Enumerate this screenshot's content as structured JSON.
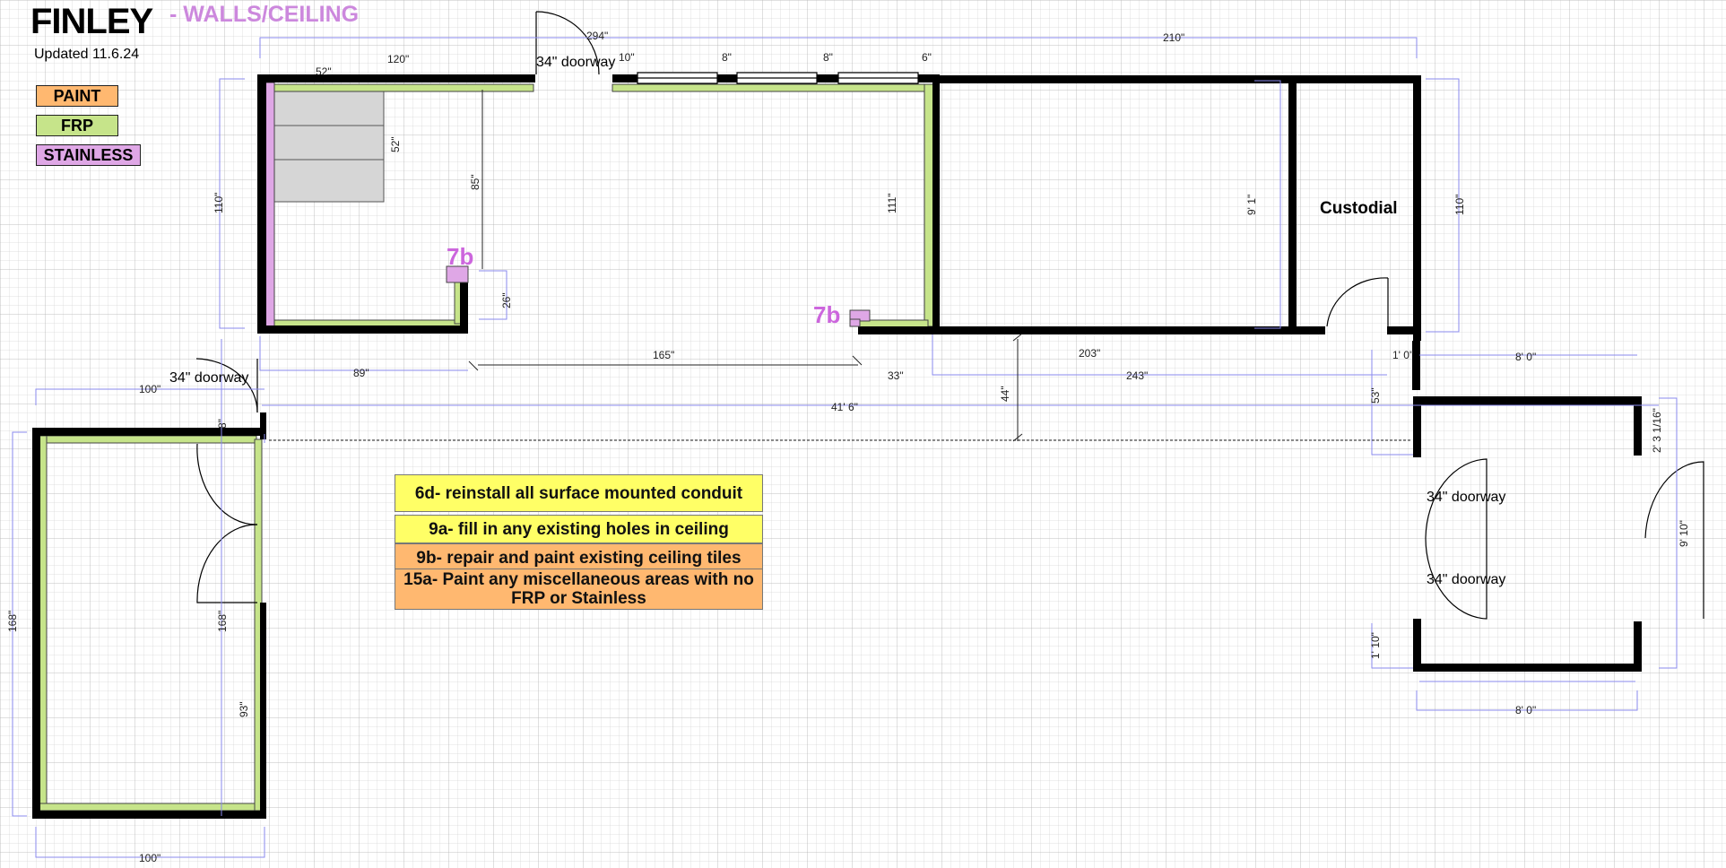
{
  "header": {
    "title": "FINLEY",
    "subtitle": "- WALLS/CEILING",
    "updated": "Updated 11.6.24"
  },
  "legend": {
    "items": [
      {
        "label": "PAINT",
        "color": "#ffb870"
      },
      {
        "label": "FRP",
        "color": "#c6e48a"
      },
      {
        "label": "STAINLESS",
        "color": "#dfa7e6"
      }
    ]
  },
  "notes": [
    {
      "text": "6d- reinstall all surface mounted conduit",
      "color": "#ffff66"
    },
    {
      "text": "9a- fill in any existing holes in ceiling",
      "color": "#ffff66"
    },
    {
      "text": "9b- repair and paint existing ceiling tiles",
      "color": "#ffb870"
    },
    {
      "text": "15a- Paint any miscellaneous areas with no FRP or Stainless",
      "color": "#ffb870"
    }
  ],
  "rooms": {
    "custodial": "Custodial"
  },
  "markers": {
    "marker_7b_a": "7b",
    "marker_7b_b": "7b"
  },
  "doorways": {
    "top": "34\" doorway",
    "left": "34\" doorway",
    "right_upper": "34\" doorway",
    "right_lower": "34\" doorway"
  },
  "dimensions": {
    "d294": "294\"",
    "d210": "210\"",
    "d52a": "52\"",
    "d120": "120\"",
    "d10": "10\"",
    "d8a": "8\"",
    "d8b": "8\"",
    "d6": "6\"",
    "d52b": "52\"",
    "d85": "85\"",
    "d110a": "110\"",
    "d111": "111\"",
    "d9_1": "9' 1\"",
    "d110b": "110\"",
    "d26": "26\"",
    "d89": "89\"",
    "d165": "165\"",
    "d33": "33\"",
    "d203": "203\"",
    "d243": "243\"",
    "d1_0": "1' 0\"",
    "d8_0a": "8' 0\"",
    "d100a": "100\"",
    "d41_6": "41' 6\"",
    "d44": "44\"",
    "d53": "53\"",
    "d2_3": "2' 3 1/16\"",
    "d8left": "8\"",
    "d168a": "168\"",
    "d168b": "168\"",
    "d93": "93\"",
    "d9_10": "9' 10\"",
    "d1_10": "1' 10\"",
    "d8_0b": "8' 0\"",
    "d100b": "100\""
  },
  "colors": {
    "frp": "#c6e48a",
    "stainless": "#dfa7e6",
    "paint": "#ffb870",
    "wall": "#000000",
    "dimension_line": "#8a8aee",
    "marker": "#cc66dd"
  }
}
